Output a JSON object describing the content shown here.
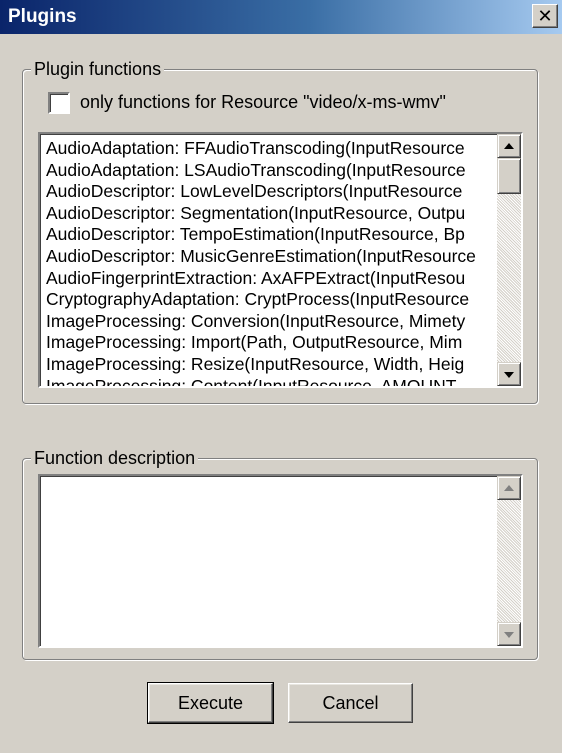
{
  "window": {
    "title": "Plugins",
    "close_glyph": "✕"
  },
  "plugin_functions": {
    "legend": "Plugin functions",
    "filter_checkbox": {
      "label": "only functions for Resource \"video/x-ms-wmv\"",
      "checked": false
    },
    "items": [
      "AudioAdaptation: FFAudioTranscoding(InputResource",
      "AudioAdaptation: LSAudioTranscoding(InputResource",
      "AudioDescriptor: LowLevelDescriptors(InputResource",
      "AudioDescriptor: Segmentation(InputResource, Outpu",
      "AudioDescriptor: TempoEstimation(InputResource, Bp",
      "AudioDescriptor: MusicGenreEstimation(InputResource",
      "AudioFingerprintExtraction: AxAFPExtract(InputResou",
      "CryptographyAdaptation: CryptProcess(InputResource",
      "ImageProcessing: Conversion(InputResource, Mimety",
      "ImageProcessing: Import(Path, OutputResource, Mim",
      "ImageProcessing: Resize(InputResource, Width, Heig",
      "ImageProcessing: Content(InputResource, AMOUNT"
    ]
  },
  "function_description": {
    "legend": "Function description",
    "text": ""
  },
  "buttons": {
    "execute": "Execute",
    "cancel": "Cancel"
  },
  "icons": {
    "close": "close-icon",
    "scroll_up": "arrow-up-icon",
    "scroll_down": "arrow-down-icon"
  }
}
